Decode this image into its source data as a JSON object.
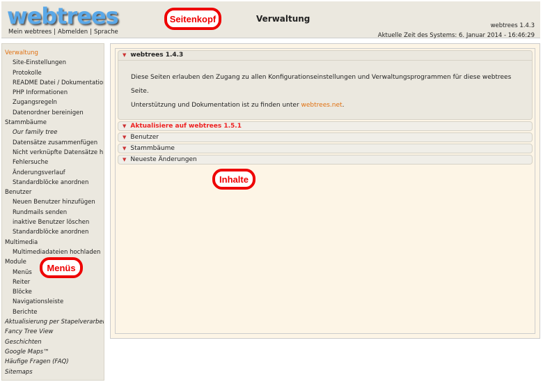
{
  "header": {
    "logo": "webtrees",
    "links": [
      "Mein webtrees",
      "Abmelden",
      "Sprache"
    ],
    "title": "Verwaltung",
    "version": "webtrees 1.4.3",
    "time": "Aktuelle Zeit des Systems: 6. Januar 2014 - 16:46:29"
  },
  "annotations": {
    "header": "Seitenkopf",
    "menus": "Menüs",
    "content": "Inhalte"
  },
  "sidebar": {
    "items": [
      {
        "label": "Verwaltung",
        "level": "h",
        "active": true
      },
      {
        "label": "Site-Einstellungen",
        "level": "sub"
      },
      {
        "label": "Protokolle",
        "level": "sub"
      },
      {
        "label": "README Datei / Dokumentation",
        "level": "sub"
      },
      {
        "label": "PHP Informationen",
        "level": "sub"
      },
      {
        "label": "Zugangsregeln",
        "level": "sub"
      },
      {
        "label": "Datenordner bereinigen",
        "level": "sub"
      },
      {
        "label": "Stammbäume",
        "level": "h"
      },
      {
        "label": "Our family tree",
        "level": "sub",
        "italic": true
      },
      {
        "label": "Datensätze zusammenfügen",
        "level": "sub"
      },
      {
        "label": "Nicht verknüpfte Datensätze hinzufügen",
        "level": "sub"
      },
      {
        "label": "Fehlersuche",
        "level": "sub"
      },
      {
        "label": "Änderungsverlauf",
        "level": "sub"
      },
      {
        "label": "Standardblöcke anordnen",
        "level": "sub"
      },
      {
        "label": "Benutzer",
        "level": "h"
      },
      {
        "label": "Neuen Benutzer hinzufügen",
        "level": "sub"
      },
      {
        "label": "Rundmails senden",
        "level": "sub"
      },
      {
        "label": "inaktive Benutzer löschen",
        "level": "sub"
      },
      {
        "label": "Standardblöcke anordnen",
        "level": "sub"
      },
      {
        "label": "Multimedia",
        "level": "h"
      },
      {
        "label": "Multimediadateien hochladen",
        "level": "sub"
      },
      {
        "label": "Module",
        "level": "h"
      },
      {
        "label": "Menüs",
        "level": "sub"
      },
      {
        "label": "Reiter",
        "level": "sub"
      },
      {
        "label": "Blöcke",
        "level": "sub"
      },
      {
        "label": "Navigationsleiste",
        "level": "sub"
      },
      {
        "label": "Berichte",
        "level": "sub"
      },
      {
        "label": "Aktualisierung per Stapelverarbeitung",
        "level": "h",
        "italic": true
      },
      {
        "label": "Fancy Tree View",
        "level": "h",
        "italic": true
      },
      {
        "label": "Geschichten",
        "level": "h",
        "italic": true
      },
      {
        "label": "Google Maps™",
        "level": "h",
        "italic": true
      },
      {
        "label": "Häufige Fragen (FAQ)",
        "level": "h",
        "italic": true
      },
      {
        "label": "Sitemaps",
        "level": "h",
        "italic": true
      }
    ]
  },
  "main": {
    "open_panel": {
      "title": "webtrees 1.4.3",
      "text1": "Diese Seiten erlauben den Zugang zu allen Konfigurationseinstellungen und Verwaltungsprogrammen für diese webtrees Seite.",
      "text2": "Unterstützung und Dokumentation ist zu finden unter ",
      "link": "webtrees.net",
      "text2_end": "."
    },
    "panels": [
      {
        "title": "Aktualisiere auf webtrees 1.5.1",
        "highlight": true
      },
      {
        "title": "Benutzer"
      },
      {
        "title": "Stammbäume"
      },
      {
        "title": "Neueste Änderungen"
      }
    ]
  },
  "colors": {
    "accent": "#e07010",
    "alert": "#ee2222",
    "annotation": "#ee0000"
  }
}
